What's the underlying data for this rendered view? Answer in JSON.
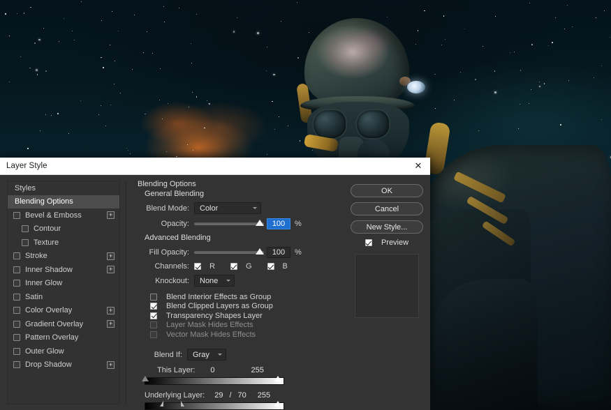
{
  "dialog": {
    "title": "Layer Style",
    "close_icon": "close-icon"
  },
  "styles_panel": {
    "items": [
      {
        "label": "Styles",
        "type": "header",
        "checkbox": false,
        "indent": false,
        "plus": false,
        "selected": false
      },
      {
        "label": "Blending Options",
        "type": "header",
        "checkbox": false,
        "indent": false,
        "plus": false,
        "selected": true
      },
      {
        "label": "Bevel & Emboss",
        "type": "effect",
        "checkbox": true,
        "checked": false,
        "indent": false,
        "plus": true,
        "selected": false
      },
      {
        "label": "Contour",
        "type": "effect",
        "checkbox": true,
        "checked": false,
        "indent": true,
        "plus": false,
        "selected": false
      },
      {
        "label": "Texture",
        "type": "effect",
        "checkbox": true,
        "checked": false,
        "indent": true,
        "plus": false,
        "selected": false
      },
      {
        "label": "Stroke",
        "type": "effect",
        "checkbox": true,
        "checked": false,
        "indent": false,
        "plus": true,
        "selected": false
      },
      {
        "label": "Inner Shadow",
        "type": "effect",
        "checkbox": true,
        "checked": false,
        "indent": false,
        "plus": true,
        "selected": false
      },
      {
        "label": "Inner Glow",
        "type": "effect",
        "checkbox": true,
        "checked": false,
        "indent": false,
        "plus": false,
        "selected": false
      },
      {
        "label": "Satin",
        "type": "effect",
        "checkbox": true,
        "checked": false,
        "indent": false,
        "plus": false,
        "selected": false
      },
      {
        "label": "Color Overlay",
        "type": "effect",
        "checkbox": true,
        "checked": false,
        "indent": false,
        "plus": true,
        "selected": false
      },
      {
        "label": "Gradient Overlay",
        "type": "effect",
        "checkbox": true,
        "checked": false,
        "indent": false,
        "plus": true,
        "selected": false
      },
      {
        "label": "Pattern Overlay",
        "type": "effect",
        "checkbox": true,
        "checked": false,
        "indent": false,
        "plus": false,
        "selected": false
      },
      {
        "label": "Outer Glow",
        "type": "effect",
        "checkbox": true,
        "checked": false,
        "indent": false,
        "plus": false,
        "selected": false
      },
      {
        "label": "Drop Shadow",
        "type": "effect",
        "checkbox": true,
        "checked": false,
        "indent": false,
        "plus": true,
        "selected": false
      }
    ]
  },
  "blending": {
    "section_title": "Blending Options",
    "general_title": "General Blending",
    "blend_mode_label": "Blend Mode:",
    "blend_mode_value": "Color",
    "opacity_label": "Opacity:",
    "opacity_value": "100",
    "opacity_unit": "%",
    "advanced_title": "Advanced Blending",
    "fill_opacity_label": "Fill Opacity:",
    "fill_opacity_value": "100",
    "fill_opacity_unit": "%",
    "channels_label": "Channels:",
    "channels": [
      {
        "label": "R",
        "checked": true
      },
      {
        "label": "G",
        "checked": true
      },
      {
        "label": "B",
        "checked": true
      }
    ],
    "knockout_label": "Knockout:",
    "knockout_value": "None",
    "options": [
      {
        "label": "Blend Interior Effects as Group",
        "checked": false,
        "disabled": false
      },
      {
        "label": "Blend Clipped Layers as Group",
        "checked": true,
        "disabled": false
      },
      {
        "label": "Transparency Shapes Layer",
        "checked": true,
        "disabled": false
      },
      {
        "label": "Layer Mask Hides Effects",
        "checked": false,
        "disabled": true
      },
      {
        "label": "Vector Mask Hides Effects",
        "checked": false,
        "disabled": true
      }
    ]
  },
  "blend_if": {
    "label": "Blend If:",
    "channel_value": "Gray",
    "this_layer": {
      "label": "This Layer:",
      "low": "0",
      "high": "255"
    },
    "underlying_layer": {
      "label": "Underlying Layer:",
      "low_a": "29",
      "separator": "/",
      "low_b": "70",
      "high": "255"
    }
  },
  "buttons": {
    "ok": "OK",
    "cancel": "Cancel",
    "new_style": "New Style...",
    "preview_label": "Preview",
    "preview_checked": true
  },
  "colors": {
    "dialog_bg": "#333333",
    "titlebar_bg": "#ffffff",
    "selection_blue": "#1f6fd0",
    "selected_row": "#4d4d4d"
  }
}
